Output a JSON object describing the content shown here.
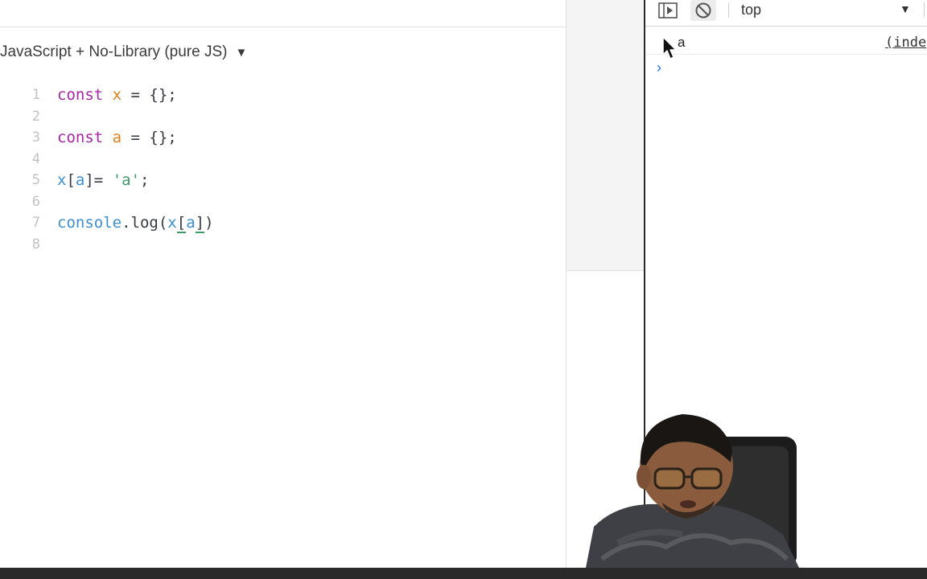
{
  "editor": {
    "language_select": "JavaScript + No-Library (pure JS)",
    "lines": [
      {
        "num": "1"
      },
      {
        "num": "2"
      },
      {
        "num": "3"
      },
      {
        "num": "4"
      },
      {
        "num": "5"
      },
      {
        "num": "6"
      },
      {
        "num": "7"
      },
      {
        "num": "8"
      }
    ],
    "code": {
      "l1_kw": "const",
      "l1_var": "x",
      "l1_rest": " = {};",
      "l3_kw": "const",
      "l3_var": "a",
      "l3_rest": " = {};",
      "l5_x": "x",
      "l5_open": "[",
      "l5_a": "a",
      "l5_close": "]= ",
      "l5_str": "'a'",
      "l5_end": ";",
      "l7_console": "console",
      "l7_log": ".log(",
      "l7_x": "x",
      "l7_open": "[",
      "l7_a": "a",
      "l7_close": "]",
      "l7_end": ")"
    }
  },
  "devtools": {
    "context": "top",
    "log_output": "a",
    "log_source": "(inde",
    "prompt": "›",
    "icons": {
      "sidebar": "sidebar-toggle-icon",
      "clear": "clear-console-icon",
      "caret": "dropdown-caret-icon"
    }
  },
  "colors": {
    "keyword": "#a626a4",
    "variable_orange": "#e0801f",
    "variable_blue": "#3d8fd1",
    "string": "#3f9a6a",
    "prompt": "#1a73e8"
  }
}
